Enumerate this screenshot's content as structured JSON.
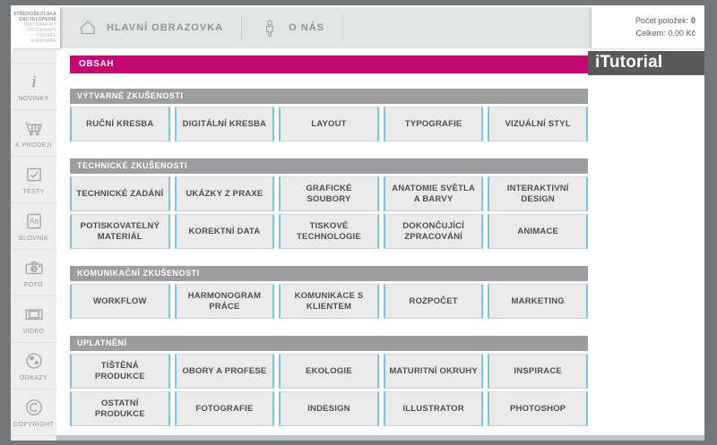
{
  "logo": {
    "lines": [
      "STŘEDOŠKOLSKÁ",
      "ENCYKLOPEDIE",
      "PRO GRAFIKY",
      "FOTOGRAFY",
      "TISKAŘE",
      "A KNIHAŘE"
    ]
  },
  "nav": {
    "items": [
      {
        "label": "HLAVNÍ OBRAZOVKA",
        "icon": "home-icon"
      },
      {
        "label": "O NÁS",
        "icon": "person-icon"
      }
    ]
  },
  "cart": {
    "count_label": "Počet položek:",
    "count_value": "0",
    "total_label": "Celkem:",
    "total_value": "0.00 Kč"
  },
  "sidebar": {
    "items": [
      {
        "label": "NOVINKY",
        "icon": "info-icon"
      },
      {
        "label": "K PRODEJI",
        "icon": "cart-icon"
      },
      {
        "label": "TESTY",
        "icon": "test-icon"
      },
      {
        "label": "SLOVNÍK",
        "icon": "dictionary-icon"
      },
      {
        "label": "FOTO",
        "icon": "camera-icon"
      },
      {
        "label": "VIDEO",
        "icon": "video-icon"
      },
      {
        "label": "ODKAZY",
        "icon": "globe-icon"
      },
      {
        "label": "COPYRIGHT",
        "icon": "copyright-icon"
      }
    ]
  },
  "content": {
    "title": "OBSAH",
    "brand": "iTutorial",
    "sections": [
      {
        "header": "VÝTVARNÉ ZKUŠENOSTI",
        "rows": [
          [
            "RUČNÍ KRESBA",
            "DIGITÁLNÍ KRESBA",
            "LAYOUT",
            "TYPOGRAFIE",
            "VIZUÁLNÍ STYL"
          ]
        ]
      },
      {
        "header": "TECHNICKÉ ZKUŠENOSTI",
        "rows": [
          [
            "TECHNICKÉ ZADÁNÍ",
            "UKÁZKY Z PRAXE",
            "GRAFICKÉ SOUBORY",
            "ANATOMIE SVĚTLA A BARVY",
            "INTERAKTIVNÍ DESIGN"
          ],
          [
            "POTISKOVATELNÝ MATERIÁL",
            "KOREKTNÍ DATA",
            "TISKOVÉ TECHNOLOGIE",
            "DOKONČUJÍCÍ ZPRACOVÁNÍ",
            "ANIMACE"
          ]
        ]
      },
      {
        "header": "KOMUNIKAČNÍ ZKUŠENOSTI",
        "rows": [
          [
            "WORKFLOW",
            "HARMONOGRAM PRÁCE",
            "KOMUNIKACE S KLIENTEM",
            "ROZPOČET",
            "MARKETING"
          ]
        ]
      },
      {
        "header": "UPLATNĚNÍ",
        "rows": [
          [
            "TIŠTĚNÁ PRODUKCE",
            "OBORY A PROFESE",
            "EKOLOGIE",
            "MATURITNÍ OKRUHY",
            "INSPIRACE"
          ],
          [
            "OSTATNÍ PRODUKCE",
            "FOTOGRAFIE",
            "INDESIGN",
            "ILLUSTRATOR",
            "PHOTOSHOP"
          ]
        ]
      }
    ]
  },
  "colors": {
    "accent_pink": "#c40872",
    "accent_cyan": "#74c8dc",
    "section_gray": "#9d9d9f",
    "brand_dark": "#595959",
    "footer_blue": "#b9c5cb",
    "frame_gray": "#757678"
  }
}
